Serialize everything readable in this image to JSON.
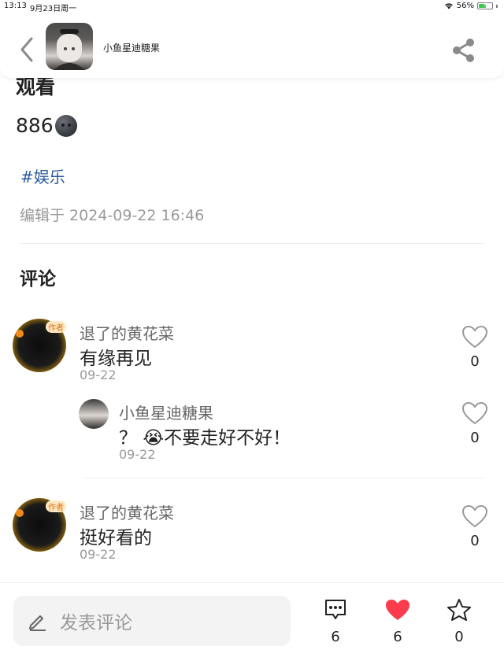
{
  "status_bar": {
    "time": "13:13",
    "date": "9月23日周一",
    "battery": "56%",
    "battery_level": 0.56
  },
  "header": {
    "author_name": "小鱼星迪糖果"
  },
  "post": {
    "partial_title": "观看",
    "body_text": "886",
    "body_emoji": "new-moon-face",
    "tag": "#娱乐",
    "edited": "编辑于 2024-09-22 16:46"
  },
  "comments_heading": "评论",
  "comments": [
    {
      "name": "退了的黄花菜",
      "badge": "作者",
      "text": "有缘再见",
      "date": "09-22",
      "likes": "0"
    },
    {
      "name": "小鱼星迪糖果",
      "text": "？ 😭不要走好不好！",
      "date": "09-22",
      "likes": "0",
      "is_reply": true
    },
    {
      "name": "退了的黄花菜",
      "badge": "作者",
      "text": "挺好看的",
      "date": "09-22",
      "likes": "0"
    }
  ],
  "bottom_bar": {
    "input_placeholder": "发表评论",
    "comment_count": "6",
    "like_count": "6",
    "star_count": "0",
    "like_color": "#fa3c4c"
  }
}
